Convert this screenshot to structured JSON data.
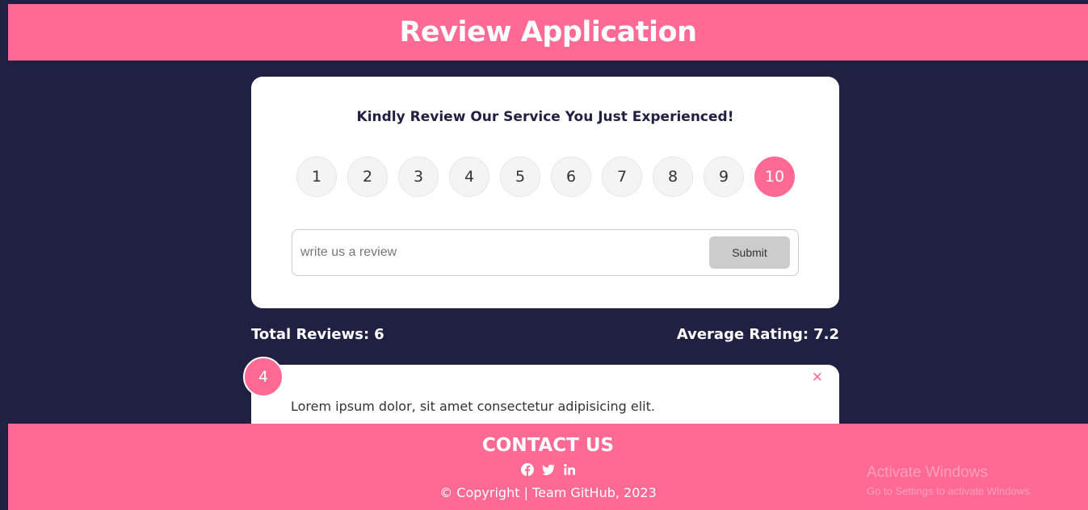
{
  "header": {
    "title": "Review Application"
  },
  "card": {
    "heading": "Kindly Review Our Service You Just Experienced!",
    "ratings": [
      "1",
      "2",
      "3",
      "4",
      "5",
      "6",
      "7",
      "8",
      "9",
      "10"
    ],
    "selected_rating": "10",
    "input_placeholder": "write us a review",
    "input_value": "",
    "submit_label": "Submit"
  },
  "stats": {
    "total_label": "Total Reviews:",
    "total_value": "6",
    "average_label": "Average Rating:",
    "average_value": "7.2"
  },
  "reviews": [
    {
      "rating": "4",
      "text": "Lorem ipsum dolor, sit amet consectetur adipisicing elit.",
      "close_symbol": "✕"
    }
  ],
  "footer": {
    "title": "CONTACT US",
    "social_icons": [
      "facebook-icon",
      "twitter-icon",
      "linkedin-icon"
    ],
    "copyright": "© Copyright | Team GitHub, 2023"
  },
  "watermark": {
    "title": "Activate Windows",
    "subtitle": "Go to Settings to activate Windows."
  },
  "colors": {
    "background": "#202142",
    "accent": "#ff6a95",
    "card": "#ffffff",
    "button_inactive": "#cccccc"
  }
}
